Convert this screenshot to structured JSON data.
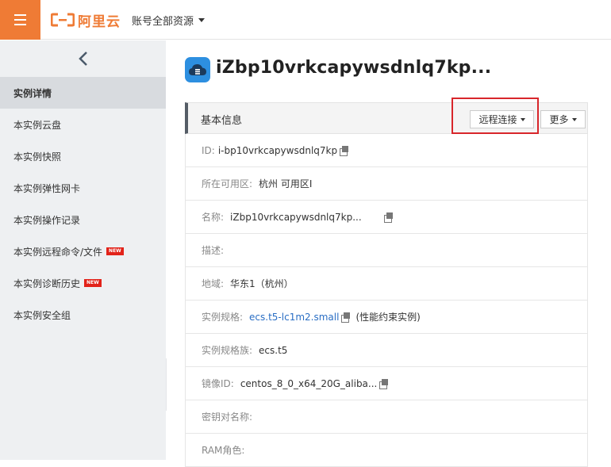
{
  "header": {
    "logo_text": "阿里云",
    "account_label": "账号全部资源"
  },
  "sidebar": {
    "items": [
      {
        "label": "实例详情",
        "active": true,
        "badge": ""
      },
      {
        "label": "本实例云盘",
        "badge": ""
      },
      {
        "label": "本实例快照",
        "badge": ""
      },
      {
        "label": "本实例弹性网卡",
        "badge": ""
      },
      {
        "label": "本实例操作记录",
        "badge": ""
      },
      {
        "label": "本实例远程命令/文件",
        "badge": "NEW"
      },
      {
        "label": "本实例诊断历史",
        "badge": "NEW"
      },
      {
        "label": "本实例安全组",
        "badge": ""
      }
    ]
  },
  "main": {
    "instance_title": "iZbp10vrkcapywsdnlq7kp...",
    "section_title": "基本信息",
    "remote_connect_label": "远程连接",
    "more_label": "更多",
    "rows": [
      {
        "label": "ID:",
        "value": "i-bp10vrkcapywsdnlq7kp"
      },
      {
        "label": "所在可用区:",
        "value": "杭州 可用区I"
      },
      {
        "label": "名称:",
        "value": "iZbp10vrkcapywsdnlq7kp..."
      },
      {
        "label": "描述:",
        "value": ""
      },
      {
        "label": "地域:",
        "value": "华东1（杭州）"
      },
      {
        "label": "实例规格:",
        "value": "ecs.t5-lc1m2.small",
        "extra": "(性能约束实例)"
      },
      {
        "label": "实例规格族:",
        "value": "ecs.t5"
      },
      {
        "label": "镜像ID:",
        "value": "centos_8_0_x64_20G_aliba..."
      },
      {
        "label": "密钥对名称:",
        "value": ""
      },
      {
        "label": "RAM角色:",
        "value": ""
      }
    ]
  },
  "colors": {
    "brand_orange": "#ef7b35",
    "link_blue": "#2a6ec4",
    "highlight_red": "#d8262b",
    "new_badge_red": "#e2231a"
  }
}
